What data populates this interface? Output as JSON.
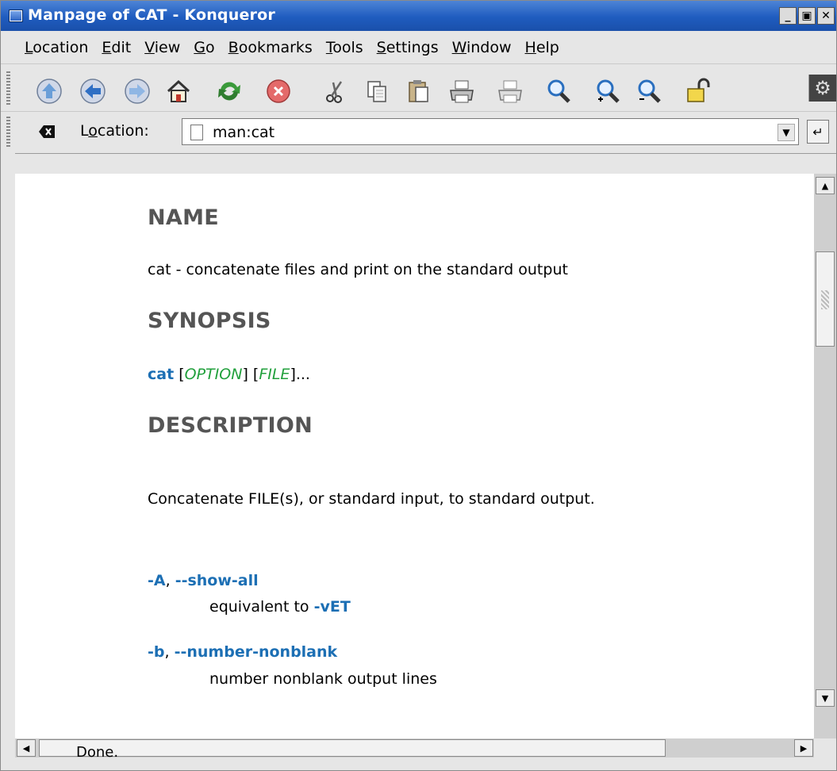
{
  "window": {
    "title": "Manpage of CAT - Konqueror",
    "controls": {
      "minimize": "_",
      "maximize": "▣",
      "close": "✕"
    }
  },
  "menubar": [
    {
      "first": "L",
      "rest": "ocation"
    },
    {
      "first": "E",
      "rest": "dit"
    },
    {
      "first": "V",
      "rest": "iew"
    },
    {
      "first": "G",
      "rest": "o"
    },
    {
      "first": "B",
      "rest": "ookmarks"
    },
    {
      "first": "T",
      "rest": "ools"
    },
    {
      "first": "S",
      "rest": "ettings"
    },
    {
      "first": "W",
      "rest": "indow"
    },
    {
      "first": "H",
      "rest": "elp"
    }
  ],
  "toolbar": {
    "icons": [
      "up-icon",
      "back-icon",
      "forward-icon",
      "home-icon",
      "reload-icon",
      "stop-icon",
      "cut-icon",
      "copy-icon",
      "paste-icon",
      "print-icon",
      "print-frame-icon",
      "zoom-icon",
      "zoom-in-icon",
      "zoom-out-icon",
      "security-lock-icon",
      "gear-icon"
    ]
  },
  "location": {
    "label_first": "L",
    "label_u": "o",
    "label_rest": "cation:",
    "value": "man:cat"
  },
  "content": {
    "name_heading": "NAME",
    "name_text": "cat - concatenate files and print on the standard output",
    "synopsis_heading": "SYNOPSIS",
    "synopsis_cmd": "cat",
    "synopsis_open1": "[",
    "synopsis_option": "OPTION",
    "synopsis_close1": "] [",
    "synopsis_file": "FILE",
    "synopsis_close2": "]...",
    "description_heading": "DESCRIPTION",
    "description_text": "Concatenate FILE(s), or standard input, to standard output.",
    "options": [
      {
        "short": "-A",
        "sep": ", ",
        "long": "--show-all",
        "desc_prefix": "equivalent to ",
        "desc_ref": "-vET"
      },
      {
        "short": "-b",
        "sep": ", ",
        "long": "--number-nonblank",
        "desc_prefix": "number nonblank output lines",
        "desc_ref": ""
      }
    ]
  },
  "status": {
    "text": "Done."
  },
  "colors": {
    "title_bar": "#1f5cbf",
    "option_blue": "#1c6fb4",
    "italic_green": "#21a03c",
    "heading_gray": "#555555"
  }
}
